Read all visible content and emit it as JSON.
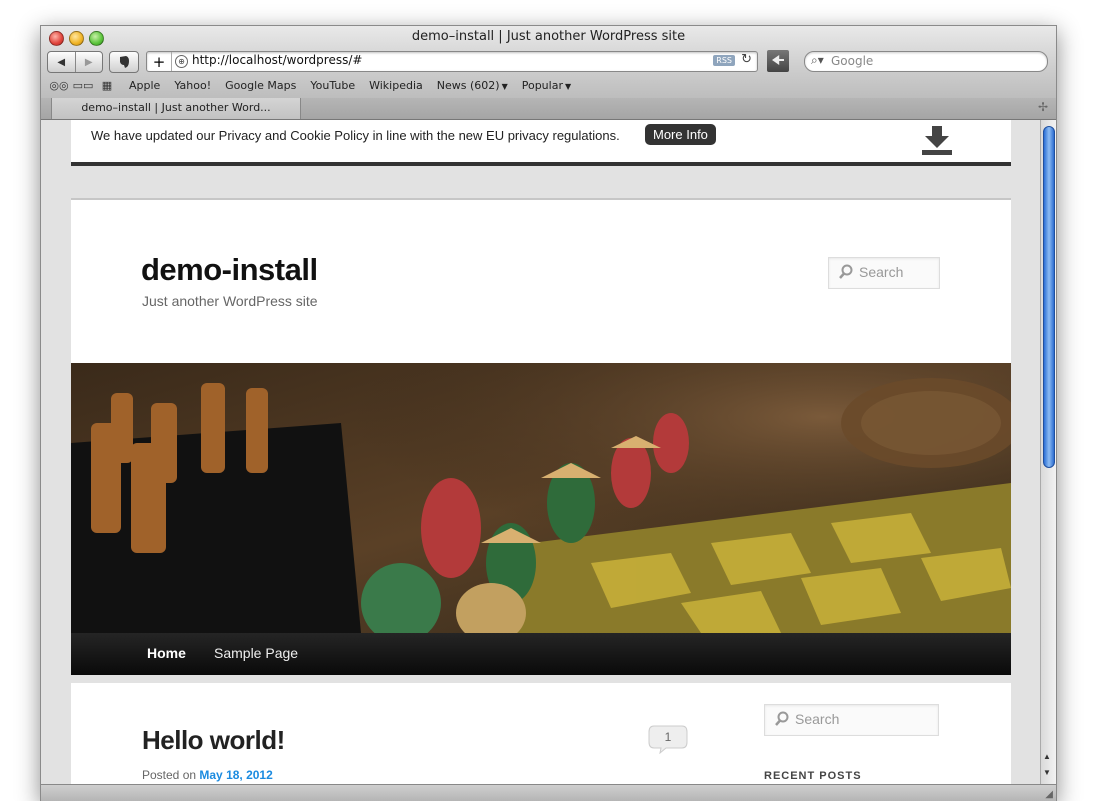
{
  "window": {
    "title": "demo–install | Just another WordPress site"
  },
  "toolbar": {
    "url": "http://localhost/wordpress/#",
    "rss_label": "RSS",
    "search_placeholder": "Google"
  },
  "bookmarks": [
    {
      "label": "Apple",
      "menu": false
    },
    {
      "label": "Yahoo!",
      "menu": false
    },
    {
      "label": "Google Maps",
      "menu": false
    },
    {
      "label": "YouTube",
      "menu": false
    },
    {
      "label": "Wikipedia",
      "menu": false
    },
    {
      "label": "News (602)",
      "menu": true
    },
    {
      "label": "Popular",
      "menu": true
    }
  ],
  "tab": {
    "label": "demo–install | Just another Word..."
  },
  "cookie": {
    "text": "We have updated our Privacy and Cookie Policy in line with the new EU privacy regulations.",
    "button": "More Info"
  },
  "site": {
    "title": "demo-install",
    "description": "Just another WordPress site",
    "search_placeholder": "Search"
  },
  "nav": {
    "items": [
      "Home",
      "Sample Page"
    ]
  },
  "post": {
    "title": "Hello world!",
    "posted_on": "Posted on",
    "date": "May 18, 2012",
    "comments": "1"
  },
  "sidebar": {
    "search_placeholder": "Search",
    "recent_heading": "RECENT POSTS"
  },
  "colors": {
    "link": "#1b8be0",
    "nav_bg": "#111111",
    "scroll_thumb": "#2b6fd6"
  }
}
